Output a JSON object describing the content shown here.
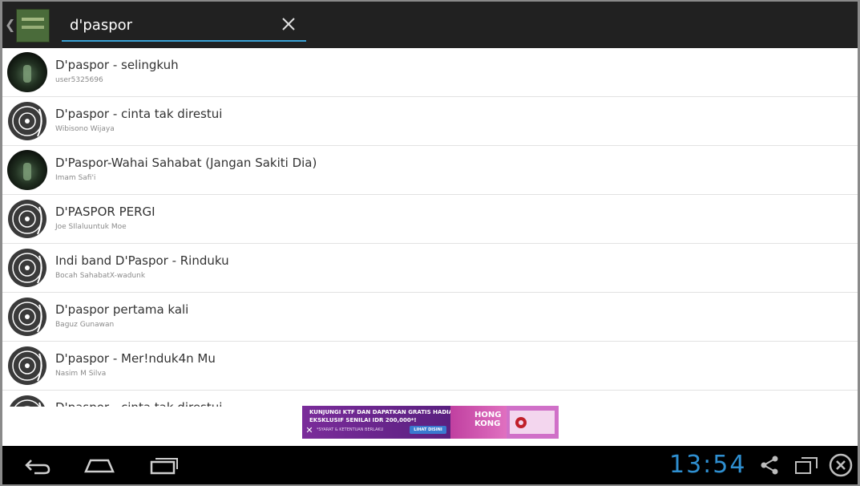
{
  "search": {
    "query": "d'paspor"
  },
  "results": [
    {
      "title": "D'paspor - selingkuh",
      "user": "user5325696",
      "artwork": "photo"
    },
    {
      "title": "D'paspor - cinta tak direstui",
      "user": "Wibisono Wijaya",
      "artwork": "vinyl-icon"
    },
    {
      "title": "D'Paspor-Wahai Sahabat (Jangan Sakiti Dia)",
      "user": "Imam Safi'i",
      "artwork": "photo"
    },
    {
      "title": "D'PASPOR PERGI",
      "user": "Joe SIlaluuntuk Moe",
      "artwork": "vinyl-icon"
    },
    {
      "title": "Indi band D'Paspor - Rinduku",
      "user": "Bocah SahabatX-wadunk",
      "artwork": "vinyl-icon"
    },
    {
      "title": "D'paspor pertama kali",
      "user": "Baguz Gunawan",
      "artwork": "vinyl-icon"
    },
    {
      "title": "D'paspor - Mer!nduk4n Mu",
      "user": "Nasim M Silva",
      "artwork": "vinyl-icon"
    },
    {
      "title": "D'paspor - cinta tak direstui",
      "user": "",
      "artwork": "vinyl-icon"
    }
  ],
  "ad": {
    "line1": "KUNJUNGI KTF DAN DAPATKAN GRATIS HADIAH",
    "line2": "EKSKLUSIF SENILAI IDR 200,000*!",
    "fine_print": "*SYARAT & KETENTUAN BERLAKU",
    "cta": "LIHAT DISINI",
    "brand_line1": "HONG",
    "brand_line2": "KONG"
  },
  "status": {
    "clock": "13:54"
  },
  "colors": {
    "accent": "#3aa2d6",
    "clock": "#2f8fd0",
    "actionbar": "#212121"
  }
}
